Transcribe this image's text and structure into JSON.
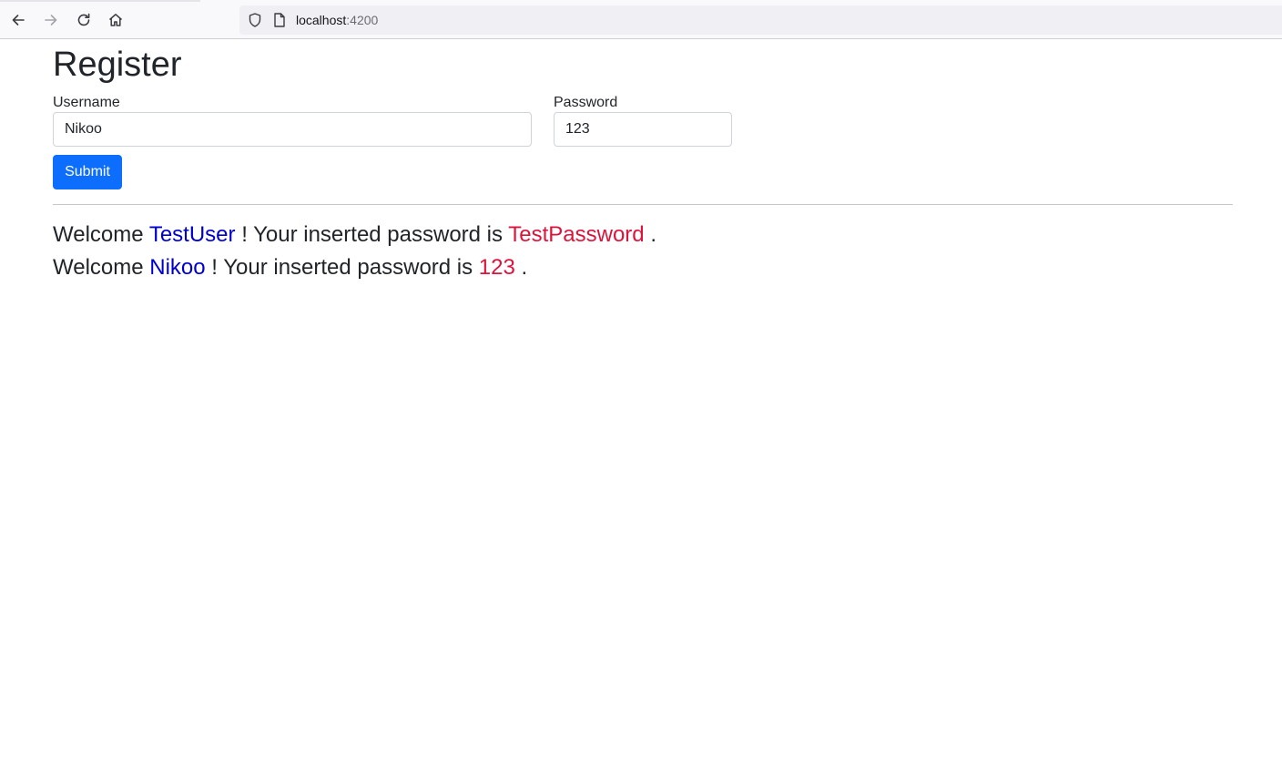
{
  "browser": {
    "url_host": "localhost",
    "url_port": ":4200"
  },
  "form": {
    "title": "Register",
    "username_label": "Username",
    "username_value": "Nikoo",
    "password_label": "Password",
    "password_value": "123",
    "submit_label": "Submit"
  },
  "greetings": [
    {
      "prefix": "Welcome",
      "username": "TestUser",
      "middle": "! Your inserted password is",
      "password": "TestPassword",
      "suffix": "."
    },
    {
      "prefix": "Welcome",
      "username": "Nikoo",
      "middle": "! Your inserted password is",
      "password": "123",
      "suffix": "."
    }
  ],
  "colors": {
    "accent": "#0d6efd",
    "username_text": "#0000cd",
    "password_text": "#dc143c"
  },
  "icons": [
    "back-arrow-icon",
    "forward-arrow-icon",
    "reload-icon",
    "home-icon",
    "shield-icon",
    "page-icon"
  ]
}
